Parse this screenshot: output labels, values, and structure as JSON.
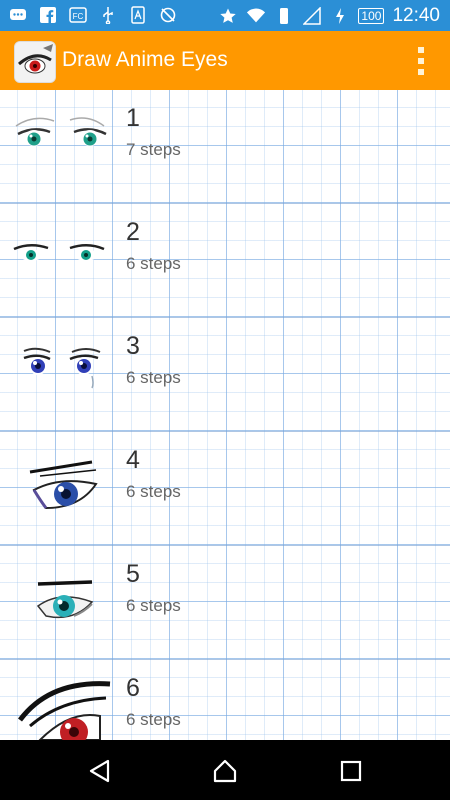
{
  "status_bar": {
    "time": "12:40",
    "battery": "100",
    "icons_left": [
      "message-icon",
      "facebook-icon",
      "fc-icon",
      "usb-icon",
      "app-icon",
      "sync-off-icon"
    ],
    "icons_right": [
      "star-icon",
      "wifi-icon",
      "vibrate-icon",
      "signal-icon",
      "charging-icon"
    ]
  },
  "app_bar": {
    "title": "Draw Anime Eyes"
  },
  "lessons": [
    {
      "number": "1",
      "steps": "7 steps"
    },
    {
      "number": "2",
      "steps": "6 steps"
    },
    {
      "number": "3",
      "steps": "6 steps"
    },
    {
      "number": "4",
      "steps": "6 steps"
    },
    {
      "number": "5",
      "steps": "6 steps"
    },
    {
      "number": "6",
      "steps": "6 steps"
    }
  ],
  "colors": {
    "status_bar": "#2b8fd6",
    "app_bar": "#ff9800",
    "grid_line": "#78aae1"
  }
}
